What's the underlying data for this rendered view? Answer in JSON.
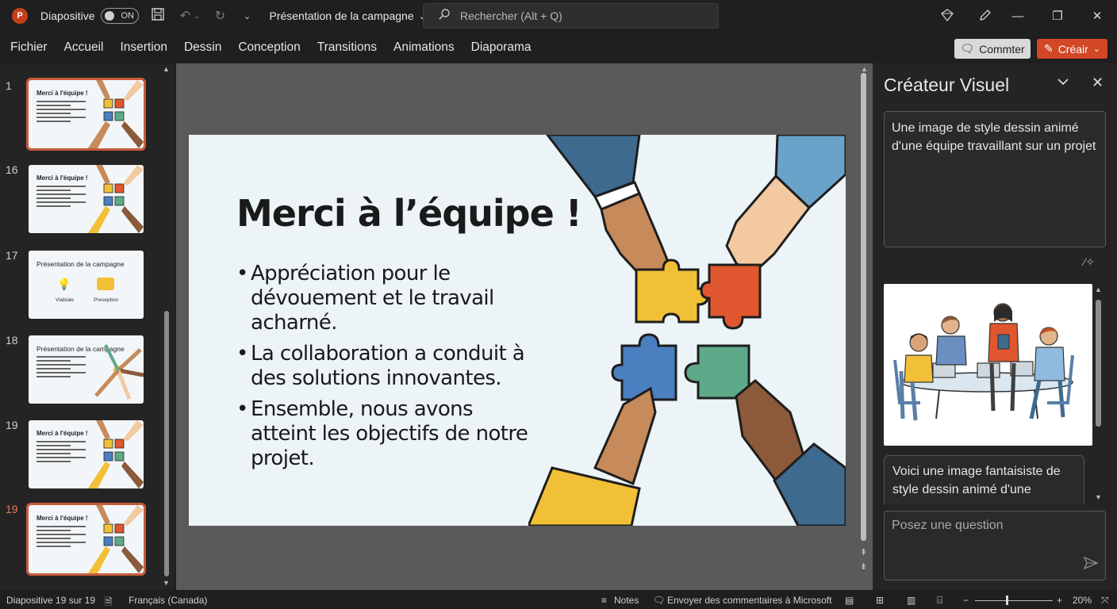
{
  "titlebar": {
    "autosave_label": "Diapositive",
    "toggle_state": "ON",
    "doc_title": "Présentation de la campagne",
    "search_placeholder": "Rechercher (Alt + Q)"
  },
  "ribbon": {
    "tabs": [
      "Fichier",
      "Accueil",
      "Insertion",
      "Dessin",
      "Conception",
      "Transitions",
      "Animations",
      "Diaporama"
    ],
    "comment_label": "Commter",
    "create_label": "Créair"
  },
  "thumbnails": [
    {
      "number": "1",
      "title": "Merci à l'équipe !",
      "selected": true
    },
    {
      "number": "16",
      "title": "Merci à l'équipe !",
      "selected": false
    },
    {
      "number": "17",
      "title": "Présentation de la campagne",
      "selected": false,
      "caption_left": "Viabiale",
      "caption_right": "Preseption"
    },
    {
      "number": "18",
      "title": "Présentation de la campagne",
      "selected": false
    },
    {
      "number": "19",
      "title": "Merci à l'équipe !",
      "selected": false
    },
    {
      "number": "19",
      "title": "Merci à l'équipe !",
      "selected": true
    }
  ],
  "slide": {
    "title": "Merci à l’équipe !",
    "bullets": [
      "Appréciation pour le dévouement et le travail acharné.",
      "La collaboration a conduit à des solutions innovantes.",
      "Ensemble, nous avons atteint les objectifs de notre projet."
    ]
  },
  "pane": {
    "title": "Créateur Visuel",
    "prompt": "Une image de style dessin animé d'une équipe travaillant sur un projet",
    "result_message": "Voici une image fantaisiste de style dessin animé d'une",
    "ask_placeholder": "Posez une question"
  },
  "statusbar": {
    "slide_counter": "Diapositive 19 sur 19",
    "language": "Français (Canada)",
    "notes": "Notes",
    "feedback": "Envoyer des commentaires à Microsoft",
    "zoom": "20%"
  },
  "colors": {
    "accent": "#d24726",
    "selection": "#c75b3c",
    "puzzle_yellow": "#f2c037",
    "puzzle_orange": "#e0562f",
    "puzzle_blue": "#4a7fc0",
    "puzzle_green": "#5ea98a"
  },
  "icons": {
    "save": "save-icon",
    "undo": "undo-icon",
    "redo": "redo-icon",
    "search": "search-icon",
    "send": "send-icon"
  }
}
